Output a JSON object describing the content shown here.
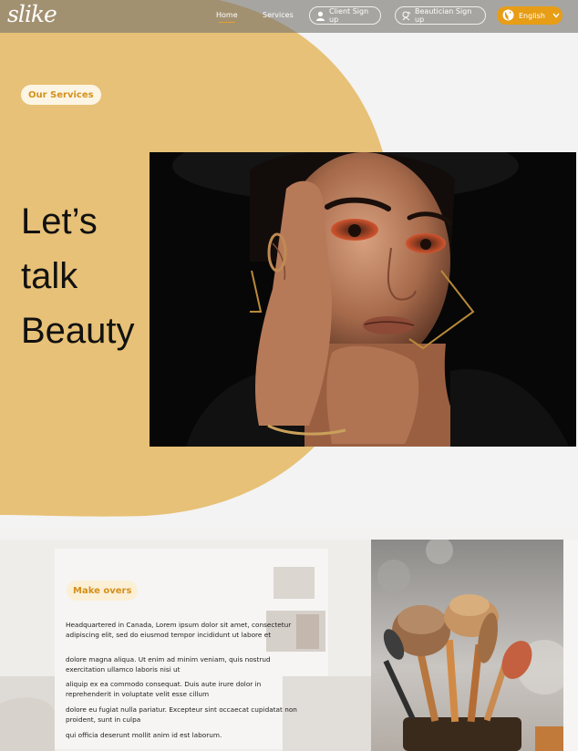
{
  "nav": {
    "logo": "slike",
    "links": [
      {
        "label": "Home",
        "active": true
      },
      {
        "label": "Services",
        "active": false
      }
    ],
    "client_signup": "Client Sign up",
    "beautician_signup": "Beautician Sign up",
    "language": "English"
  },
  "hero": {
    "badge": "Our Services",
    "title_lines": [
      "Let’s",
      "talk",
      "Beauty"
    ]
  },
  "makeovers": {
    "badge": "Make overs",
    "paragraphs": [
      "Headquartered in Canada,  Lorem ipsum dolor sit amet, consectetur adipiscing elit, sed do eiusmod tempor incididunt ut labore et",
      "dolore magna aliqua. Ut enim ad minim veniam, quis nostrud exercitation ullamco laboris nisi ut",
      "aliquip ex ea commodo consequat. Duis aute irure dolor in reprehenderit in voluptate velit esse cillum",
      "dolore eu fugiat nulla pariatur. Excepteur sint occaecat cupidatat non proident, sunt in culpa",
      "qui officia deserunt mollit anim id est laborum."
    ]
  },
  "colors": {
    "accent": "#e79d16",
    "hero_shape": "#e7c177",
    "badge_text": "#d4901a"
  }
}
